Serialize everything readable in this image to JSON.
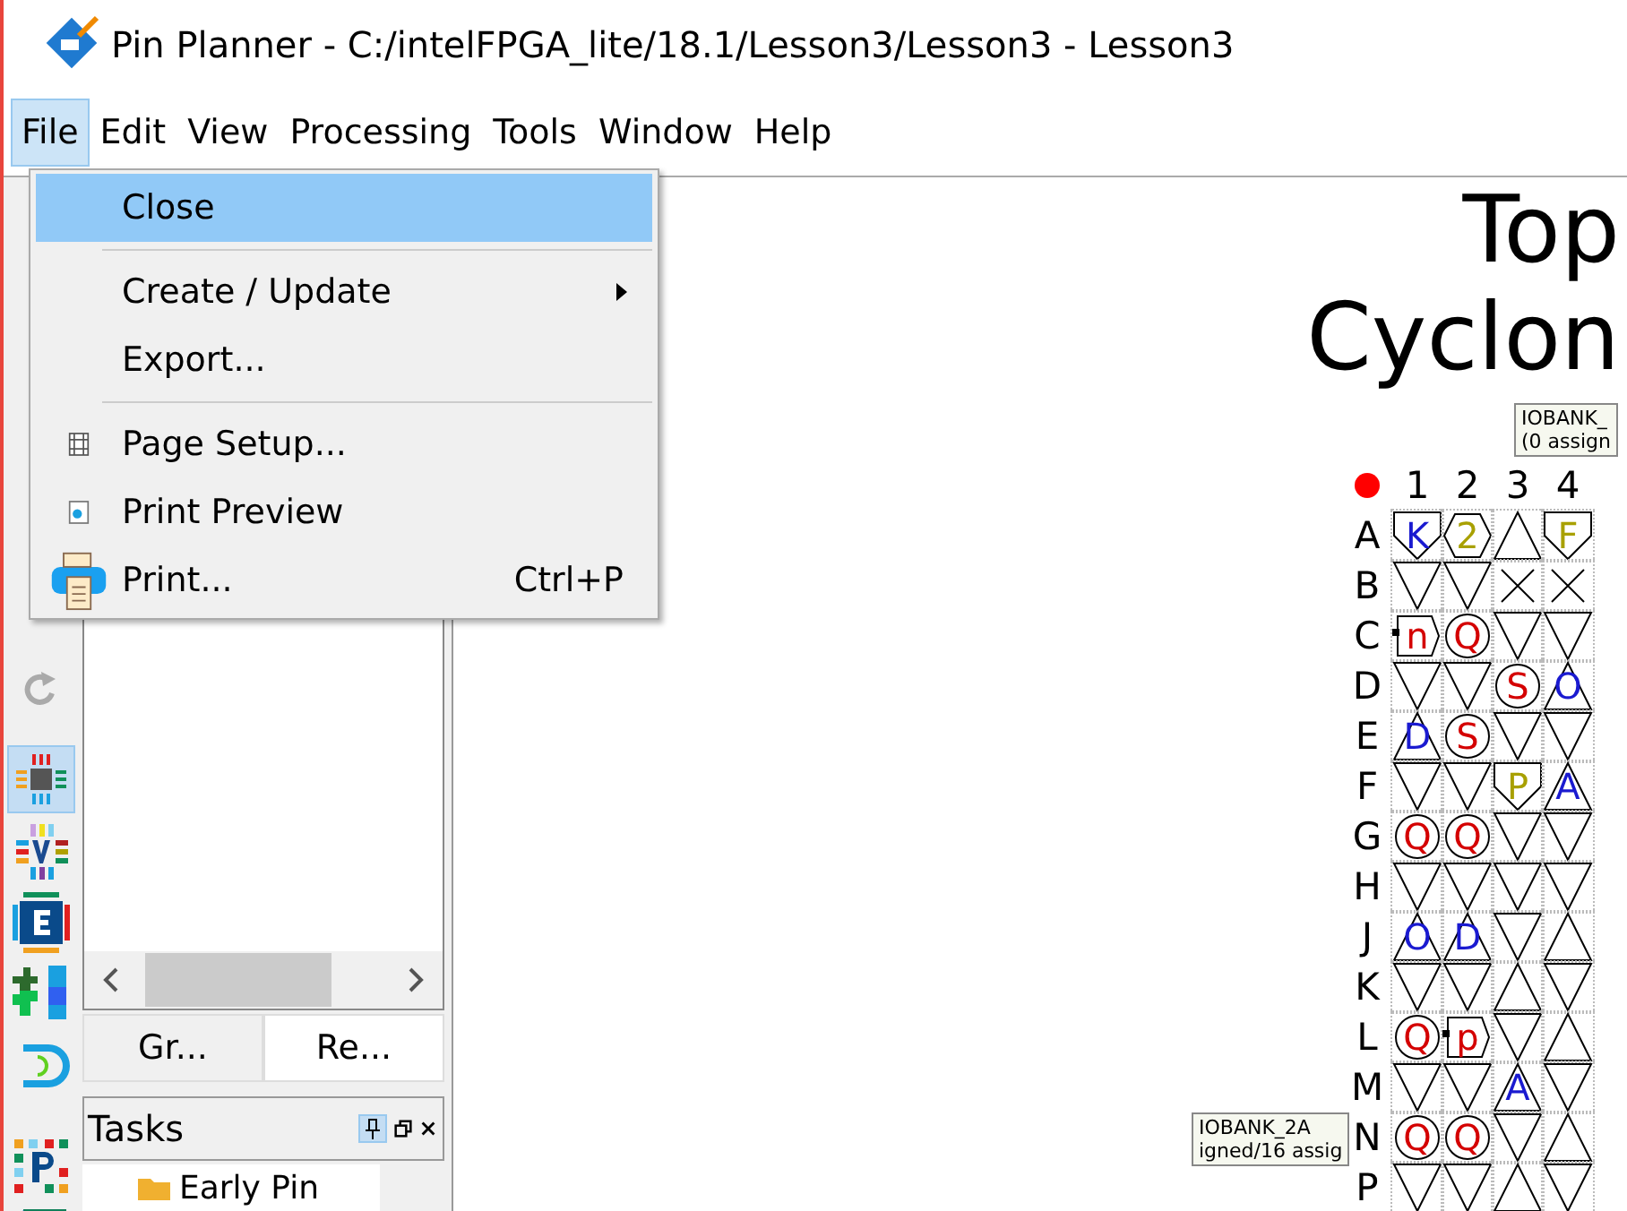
{
  "window": {
    "title": "Pin Planner - C:/intelFPGA_lite/18.1/Lesson3/Lesson3 - Lesson3"
  },
  "menu_bar": [
    {
      "label": "File",
      "selected": true
    },
    {
      "label": "Edit",
      "selected": false
    },
    {
      "label": "View",
      "selected": false
    },
    {
      "label": "Processing",
      "selected": false
    },
    {
      "label": "Tools",
      "selected": false
    },
    {
      "label": "Window",
      "selected": false
    },
    {
      "label": "Help",
      "selected": false
    }
  ],
  "file_menu": [
    {
      "kind": "item",
      "label": "Close",
      "selected": true
    },
    {
      "kind": "separator"
    },
    {
      "kind": "submenu",
      "label": "Create / Update",
      "selected": false
    },
    {
      "kind": "item",
      "label": "Export...",
      "selected": false
    },
    {
      "kind": "separator"
    },
    {
      "kind": "setup",
      "label": "Page Setup...",
      "selected": false
    },
    {
      "kind": "preview",
      "label": "Print Preview",
      "selected": false
    },
    {
      "kind": "print",
      "label": "Print...",
      "shortcut": "Ctrl+P",
      "selected": false
    }
  ],
  "side_tabs": [
    {
      "label": "Gr...",
      "selected": false
    },
    {
      "label": "Re...",
      "selected": true
    }
  ],
  "tasks": {
    "title": "Tasks",
    "tree_item": "Early Pin"
  },
  "canvas": {
    "title_lines": [
      "Top",
      "Cyclon"
    ],
    "bank_labels": [
      {
        "lines": [
          "IOBANK_",
          "(0 assign"
        ]
      },
      {
        "lines": [
          "IOBANK_2A",
          "igned/16 assig"
        ]
      }
    ],
    "columns": [
      "1",
      "2",
      "3",
      "4"
    ],
    "rows": [
      {
        "label": "A",
        "pins": [
          {
            "kind": "pentagon",
            "letter": "K",
            "color": "#1a1ad0"
          },
          {
            "kind": "hexagon",
            "letter": "2",
            "color": "#a8a000"
          },
          {
            "kind": "tri_up"
          },
          {
            "kind": "pentagon",
            "letter": "F",
            "color": "#a8a000"
          }
        ]
      },
      {
        "label": "B",
        "pins": [
          {
            "kind": "tri_down"
          },
          {
            "kind": "tri_down"
          },
          {
            "kind": "cross"
          },
          {
            "kind": "cross"
          }
        ]
      },
      {
        "label": "C",
        "pins": [
          {
            "kind": "pad",
            "letter": "n",
            "color": "#d40000"
          },
          {
            "kind": "circle",
            "letter": "Q",
            "color": "#d40000"
          },
          {
            "kind": "tri_down"
          },
          {
            "kind": "tri_down"
          }
        ]
      },
      {
        "label": "D",
        "pins": [
          {
            "kind": "tri_down"
          },
          {
            "kind": "tri_down"
          },
          {
            "kind": "circle",
            "letter": "S",
            "color": "#d40000"
          },
          {
            "kind": "tri_up",
            "letter": "O",
            "color": "#1a1ad0"
          }
        ]
      },
      {
        "label": "E",
        "pins": [
          {
            "kind": "tri_up",
            "letter": "D",
            "color": "#1a1ad0"
          },
          {
            "kind": "circle",
            "letter": "S",
            "color": "#d40000"
          },
          {
            "kind": "tri_down"
          },
          {
            "kind": "tri_down"
          }
        ]
      },
      {
        "label": "F",
        "pins": [
          {
            "kind": "tri_down"
          },
          {
            "kind": "tri_down"
          },
          {
            "kind": "pentagon",
            "letter": "P",
            "color": "#a8a000"
          },
          {
            "kind": "tri_up",
            "letter": "A",
            "color": "#1a1ad0"
          }
        ]
      },
      {
        "label": "G",
        "pins": [
          {
            "kind": "circle",
            "letter": "Q",
            "color": "#d40000"
          },
          {
            "kind": "circle",
            "letter": "Q",
            "color": "#d40000"
          },
          {
            "kind": "tri_down"
          },
          {
            "kind": "tri_down"
          }
        ]
      },
      {
        "label": "H",
        "pins": [
          {
            "kind": "tri_down"
          },
          {
            "kind": "tri_down"
          },
          {
            "kind": "tri_down"
          },
          {
            "kind": "tri_down"
          }
        ]
      },
      {
        "label": "J",
        "pins": [
          {
            "kind": "tri_up",
            "letter": "O",
            "color": "#1a1ad0"
          },
          {
            "kind": "tri_up",
            "letter": "D",
            "color": "#1a1ad0"
          },
          {
            "kind": "tri_down"
          },
          {
            "kind": "tri_up"
          }
        ]
      },
      {
        "label": "K",
        "pins": [
          {
            "kind": "tri_down"
          },
          {
            "kind": "tri_down"
          },
          {
            "kind": "tri_up"
          },
          {
            "kind": "tri_down"
          }
        ]
      },
      {
        "label": "L",
        "pins": [
          {
            "kind": "circle",
            "letter": "Q",
            "color": "#d40000"
          },
          {
            "kind": "pad",
            "letter": "p",
            "color": "#d40000"
          },
          {
            "kind": "tri_down"
          },
          {
            "kind": "tri_up"
          }
        ]
      },
      {
        "label": "M",
        "pins": [
          {
            "kind": "tri_down"
          },
          {
            "kind": "tri_down"
          },
          {
            "kind": "tri_up",
            "letter": "A",
            "color": "#1a1ad0"
          },
          {
            "kind": "tri_down"
          }
        ]
      },
      {
        "label": "N",
        "pins": [
          {
            "kind": "circle",
            "letter": "Q",
            "color": "#d40000"
          },
          {
            "kind": "circle",
            "letter": "Q",
            "color": "#d40000"
          },
          {
            "kind": "tri_down"
          },
          {
            "kind": "tri_up"
          }
        ]
      },
      {
        "label": "P",
        "pins": [
          {
            "kind": "tri_down"
          },
          {
            "kind": "tri_down"
          },
          {
            "kind": "tri_up"
          },
          {
            "kind": "tri_down"
          }
        ]
      }
    ]
  }
}
